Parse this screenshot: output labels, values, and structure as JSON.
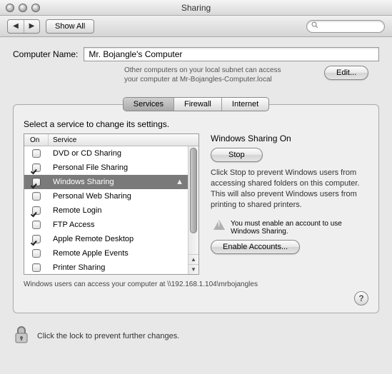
{
  "window": {
    "title": "Sharing"
  },
  "toolbar": {
    "show_all": "Show All",
    "search_placeholder": ""
  },
  "computer_name": {
    "label": "Computer Name:",
    "value": "Mr. Bojangle's Computer",
    "subnet_line1": "Other computers on your local subnet can access",
    "subnet_line2": "your computer at Mr-Bojangles-Computer.local",
    "edit": "Edit..."
  },
  "tabs": {
    "services": "Services",
    "firewall": "Firewall",
    "internet": "Internet"
  },
  "instructions": "Select a service to change its settings.",
  "columns": {
    "on": "On",
    "service": "Service"
  },
  "services": [
    {
      "on": false,
      "label": "DVD or CD Sharing"
    },
    {
      "on": true,
      "label": "Personal File Sharing"
    },
    {
      "on": true,
      "label": "Windows Sharing",
      "selected": true,
      "warn": true
    },
    {
      "on": false,
      "label": "Personal Web Sharing"
    },
    {
      "on": true,
      "label": "Remote Login"
    },
    {
      "on": false,
      "label": "FTP Access"
    },
    {
      "on": true,
      "label": "Apple Remote Desktop"
    },
    {
      "on": false,
      "label": "Remote Apple Events"
    },
    {
      "on": false,
      "label": "Printer Sharing"
    }
  ],
  "detail": {
    "title": "Windows Sharing On",
    "stop": "Stop",
    "desc": "Click Stop to prevent Windows users from accessing shared folders on this computer. This will also prevent Windows users from printing to shared printers.",
    "warn": "You must enable an account to use Windows Sharing.",
    "enable": "Enable Accounts..."
  },
  "access_note": "Windows users can access your computer at \\\\192.168.1.104\\mrbojangles",
  "help": "?",
  "lock_text": "Click the lock to prevent further changes."
}
